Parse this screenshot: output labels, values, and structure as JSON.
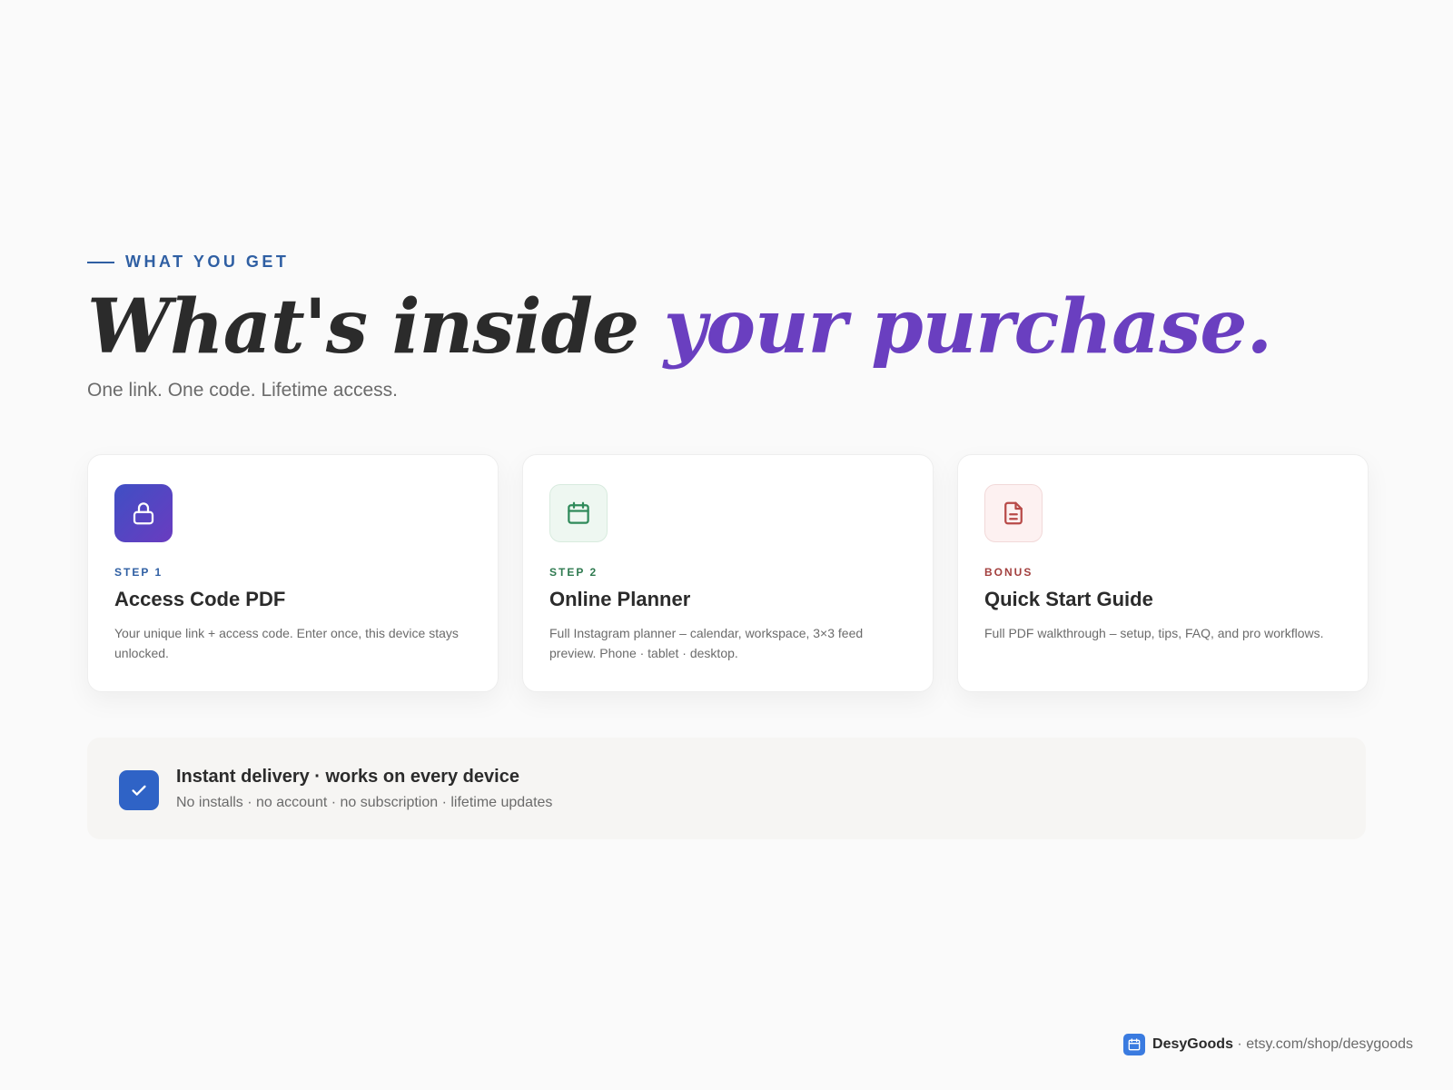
{
  "section": {
    "eyebrow": "WHAT YOU GET",
    "headline_main": "What's inside ",
    "headline_accent": "your purchase.",
    "subheadline": "One link. One code. Lifetime access."
  },
  "cards": [
    {
      "icon": "lock-icon",
      "tag": "STEP 1",
      "title": "Access Code PDF",
      "description": "Your unique link + access code. Enter once, this device stays unlocked."
    },
    {
      "icon": "calendar-icon",
      "tag": "STEP 2",
      "title": "Online Planner",
      "description": "Full Instagram planner – calendar, workspace, 3×3 feed preview. Phone · tablet · desktop."
    },
    {
      "icon": "document-icon",
      "tag": "BONUS",
      "title": "Quick Start Guide",
      "description": "Full PDF walkthrough – setup, tips, FAQ, and pro workflows."
    }
  ],
  "delivery": {
    "icon": "checkmark-icon",
    "title": "Instant delivery · works on every device",
    "subtitle": "No installs · no account · no subscription · lifetime updates"
  },
  "footer": {
    "brand": "DesyGoods",
    "separator": " · ",
    "url": "etsy.com/shop/desygoods"
  },
  "colors": {
    "accent_purple": "#6a3fc0",
    "eyebrow_blue": "#2f5fa3",
    "step2_green": "#2f7a50",
    "bonus_red": "#a3403f",
    "check_blue": "#2f63c6"
  }
}
